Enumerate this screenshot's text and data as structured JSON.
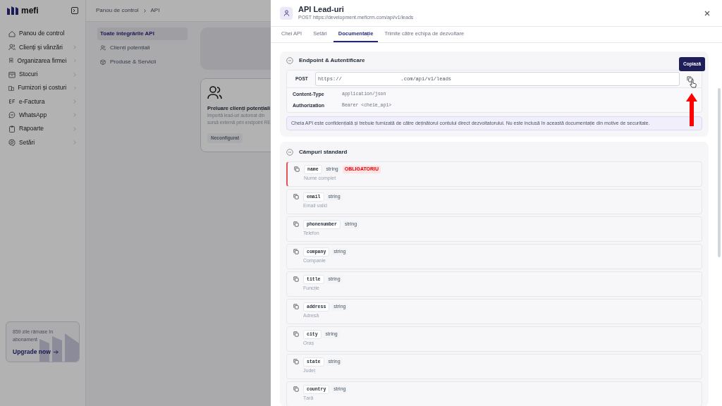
{
  "sidebar": {
    "logo": "mefi",
    "items": [
      {
        "label": "Panou de control",
        "chevron": false
      },
      {
        "label": "Clienți și vânzări",
        "chevron": true
      },
      {
        "label": "Organizarea firmei",
        "chevron": true
      },
      {
        "label": "Stocuri",
        "chevron": true
      },
      {
        "label": "Furnizori și costuri",
        "chevron": true
      },
      {
        "label": "e-Factura",
        "chevron": true
      },
      {
        "label": "WhatsApp",
        "chevron": true
      },
      {
        "label": "Rapoarte",
        "chevron": true
      },
      {
        "label": "Setări",
        "chevron": true
      }
    ],
    "subscription": {
      "text": "859 zile rămase în abonament",
      "link": "Upgrade now"
    }
  },
  "breadcrumb": [
    "Panou de control",
    "API"
  ],
  "submenu": [
    {
      "label": "Toate integrările API",
      "selected": true
    },
    {
      "label": "Clienți potențiali",
      "selected": false
    },
    {
      "label": "Produse & Servicii",
      "selected": false
    }
  ],
  "card": {
    "title": "Preluare clienți potențiali",
    "description": [
      "Importă lead-uri automat din",
      "sursă externă prin endpoint RE"
    ],
    "badge": "Neconfigurat"
  },
  "modal": {
    "title": "API Lead-uri",
    "subtitle": "POST https://development.meficrm.com/api/v1/leads",
    "tabs": [
      {
        "label": "Chei API",
        "selected": false
      },
      {
        "label": "Setări",
        "selected": false
      },
      {
        "label": "Documentație",
        "selected": true
      },
      {
        "label": "Trimite către echipa de dezvoltare",
        "selected": false
      }
    ],
    "endpoint_section": {
      "title": "Endpoint & Autentificare",
      "expanded": true,
      "method": "POST",
      "url": "https://                    .com/api/v1/leads",
      "tooltip": "Copiază",
      "headers": [
        {
          "key": "Content-Type",
          "value": "application/json"
        },
        {
          "key": "Authorization",
          "value": "Bearer <cheie_api>"
        }
      ],
      "note": "Cheia API este confidențială și trebuie furnizată de către deținătorul contului direct dezvoltatorului. Nu este inclusă în această documentație din motive de securitate."
    },
    "fields_section": {
      "title": "Câmpuri standard",
      "expanded": true,
      "fields": [
        {
          "name": "name",
          "type": "string",
          "required": true,
          "badge": "OBLIGATORIU",
          "description": "Nume complet"
        },
        {
          "name": "email",
          "type": "string",
          "required": false,
          "description": "Email valid"
        },
        {
          "name": "phonenumber",
          "type": "string",
          "required": false,
          "description": "Telefon"
        },
        {
          "name": "company",
          "type": "string",
          "required": false,
          "description": "Companie"
        },
        {
          "name": "title",
          "type": "string",
          "required": false,
          "description": "Funcție"
        },
        {
          "name": "address",
          "type": "string",
          "required": false,
          "description": "Adresă"
        },
        {
          "name": "city",
          "type": "string",
          "required": false,
          "description": "Oraș"
        },
        {
          "name": "state",
          "type": "string",
          "required": false,
          "description": "Județ"
        },
        {
          "name": "country",
          "type": "string",
          "required": false,
          "description": "Țară"
        }
      ]
    }
  }
}
